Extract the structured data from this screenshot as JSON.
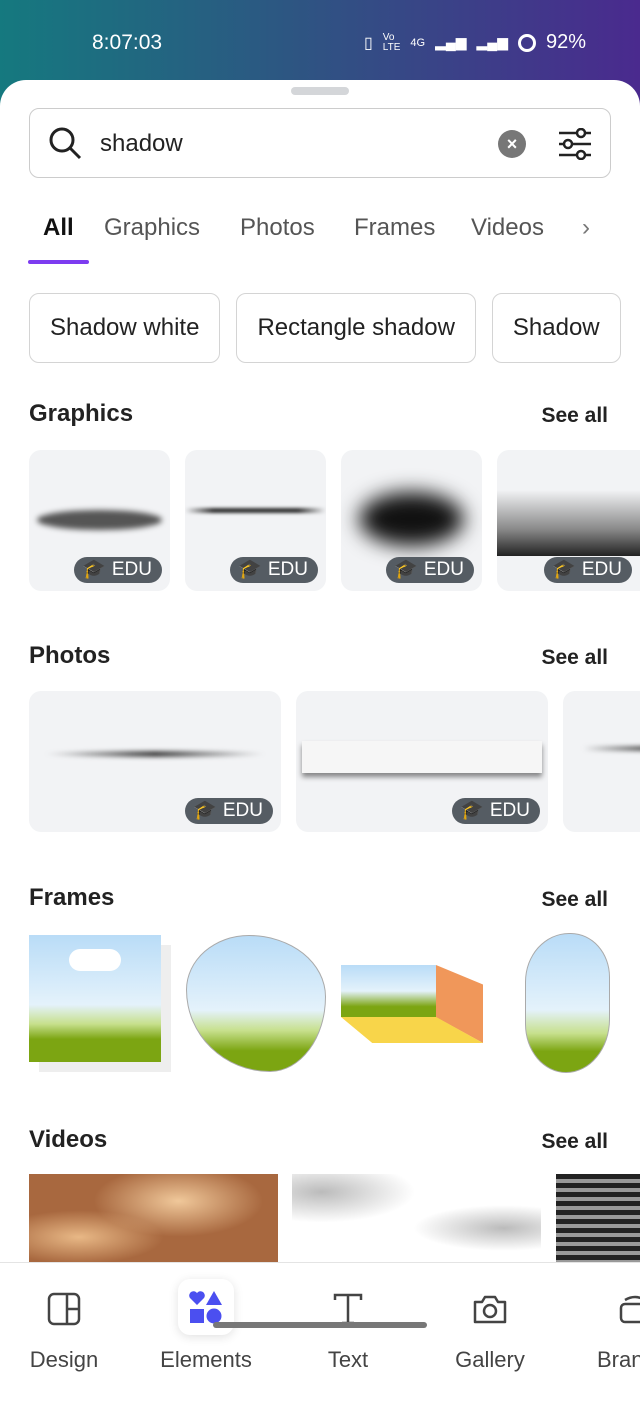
{
  "status_bar": {
    "time": "8:07:03",
    "battery": "92%",
    "network": "4G"
  },
  "search": {
    "query": "shadow"
  },
  "tabs": [
    {
      "label": "All"
    },
    {
      "label": "Graphics"
    },
    {
      "label": "Photos"
    },
    {
      "label": "Frames"
    },
    {
      "label": "Videos"
    }
  ],
  "chips": [
    {
      "label": "Shadow white"
    },
    {
      "label": "Rectangle shadow"
    },
    {
      "label": "Shadow"
    }
  ],
  "sections": {
    "graphics": {
      "title": "Graphics",
      "see_all": "See all"
    },
    "photos": {
      "title": "Photos",
      "see_all": "See all"
    },
    "frames": {
      "title": "Frames",
      "see_all": "See all"
    },
    "videos": {
      "title": "Videos",
      "see_all": "See all"
    }
  },
  "badge": "EDU",
  "nav": [
    {
      "label": "Design"
    },
    {
      "label": "Elements"
    },
    {
      "label": "Text"
    },
    {
      "label": "Gallery"
    },
    {
      "label": "Brand"
    }
  ],
  "colors": {
    "accent": "#7d3cf0",
    "elements_icon": "#4b4ff0"
  }
}
